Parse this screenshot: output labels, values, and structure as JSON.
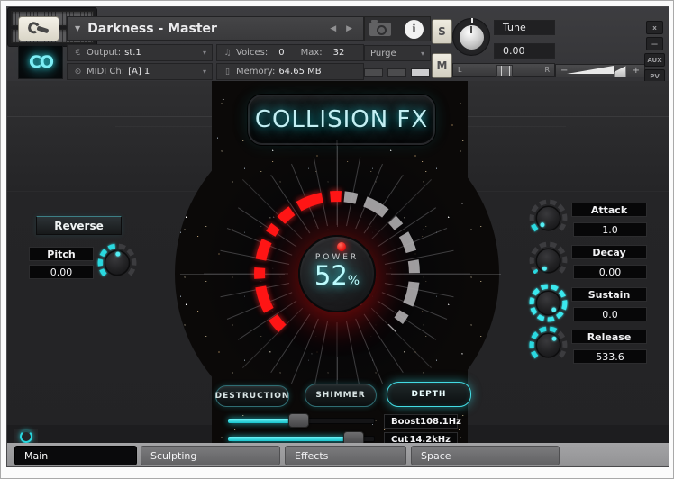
{
  "header": {
    "title": "Darkness - Master",
    "nav_arrows": "◀ ▶",
    "output": {
      "label": "Output:",
      "value": "st.1"
    },
    "midi": {
      "label": "MIDI Ch:",
      "value": "[A] 1"
    },
    "voices": {
      "label": "Voices:",
      "value": "0",
      "max_label": "Max:",
      "max_value": "32"
    },
    "memory": {
      "label": "Memory:",
      "value": "64.65 MB"
    },
    "purge_label": "Purge",
    "solo_label": "S",
    "mute_label": "M",
    "tune": {
      "label": "Tune",
      "value": "0.00"
    },
    "pan": {
      "left": "L",
      "right": "R"
    },
    "volume": {
      "minus": "−",
      "plus": "+"
    },
    "close_label": "x",
    "minimize_label": "—",
    "aux_label": "AUX",
    "pv_label": "PV",
    "logo_text": "CO"
  },
  "instrument": {
    "title": "COLLISION FX",
    "power": {
      "label": "POWER",
      "value": "52",
      "unit": "%",
      "fraction": 0.52
    },
    "reverse_label": "Reverse",
    "pitch": {
      "label": "Pitch",
      "value": "0.00"
    },
    "envelope": [
      {
        "label": "Attack",
        "value": "1.0"
      },
      {
        "label": "Decay",
        "value": "0.00"
      },
      {
        "label": "Sustain",
        "value": "0.0"
      },
      {
        "label": "Release",
        "value": "533.6"
      }
    ],
    "fx_buttons": [
      {
        "label": "DESTRUCTION"
      },
      {
        "label": "SHIMMER"
      },
      {
        "label": "DEPTH",
        "active": true
      }
    ],
    "eq": [
      {
        "label": "Boost",
        "value": "108.1Hz",
        "fraction": 0.46
      },
      {
        "label": "Cut",
        "value": "14.2kHz",
        "fraction": 0.85
      }
    ]
  },
  "tabs": [
    {
      "label": "Main",
      "active": true
    },
    {
      "label": "Sculpting",
      "active": false
    },
    {
      "label": "Effects",
      "active": false
    },
    {
      "label": "Space",
      "active": false
    }
  ],
  "colors": {
    "accent": "#2bd9e0",
    "lit_red": "#ff1616"
  }
}
